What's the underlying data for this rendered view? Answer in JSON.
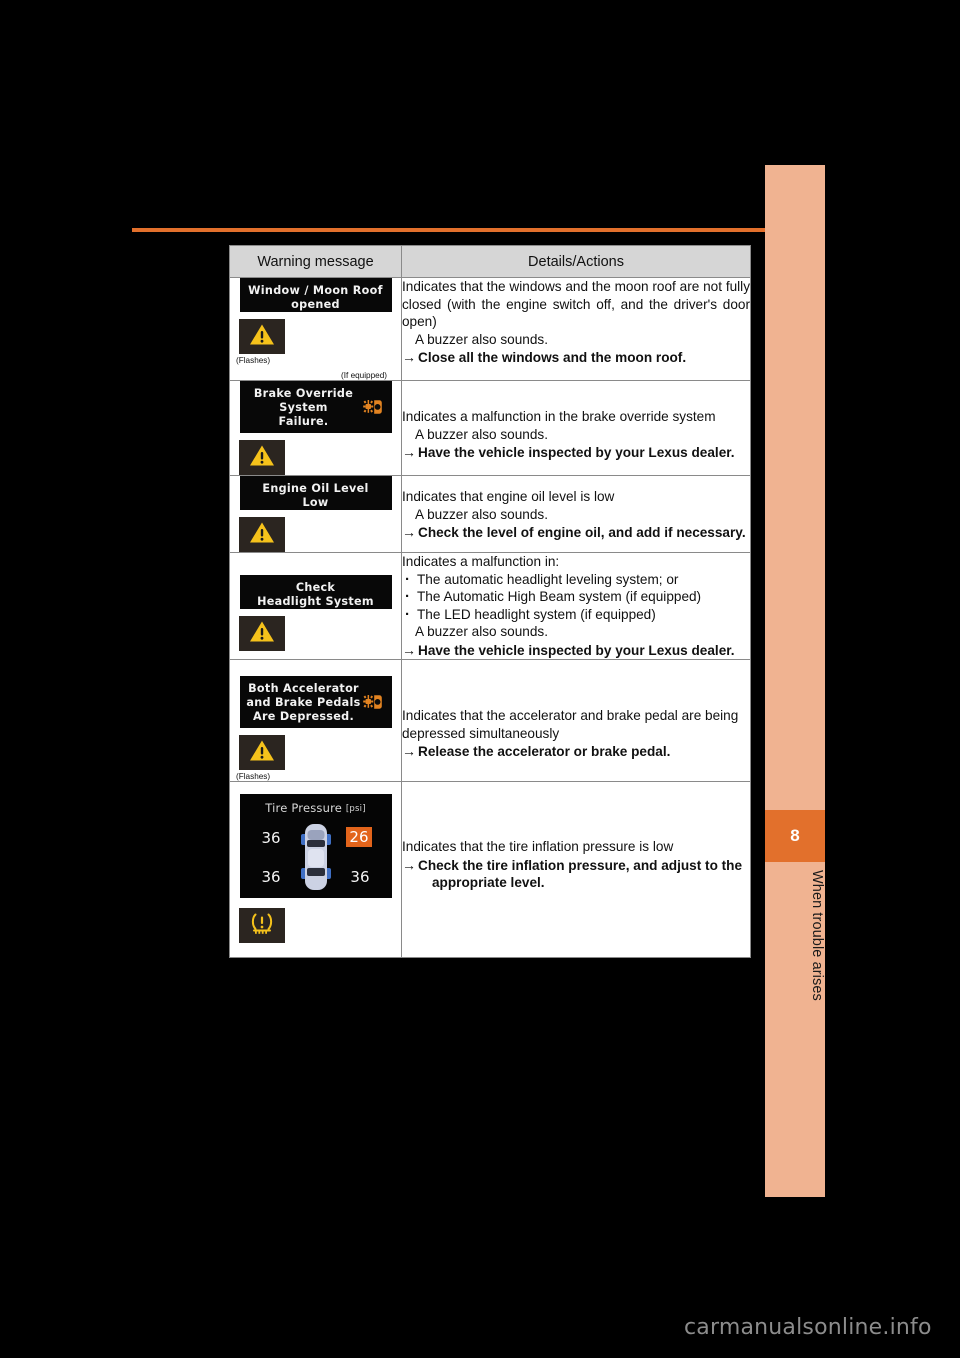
{
  "sidebar": {
    "chapter_number": "8",
    "chapter_title": "When trouble arises",
    "tab_color": "#f0b391",
    "chapter_box_color": "#e2702c"
  },
  "rule_color": "#e2702c",
  "table": {
    "headers": {
      "warning_message": "Warning message",
      "details_actions": "Details/Actions"
    },
    "rows": [
      {
        "display_lines": [
          "Window / Moon Roof",
          "opened"
        ],
        "display_icon": "none",
        "telltale": "warning-triangle-icon",
        "flashes_note": "(Flashes)",
        "if_equipped_note": "(If equipped)",
        "details_intro": "Indicates that the windows and the moon roof are not fully closed (with the engine switch off, and the driver's door open)",
        "details_buzzer": "A buzzer also sounds.",
        "action_arrow": "→",
        "action_text": "Close all the windows and the moon roof."
      },
      {
        "display_lines": [
          "Brake Override",
          "System",
          "Failure."
        ],
        "display_icon": "brake-system-icon",
        "telltale": "warning-triangle-icon",
        "flashes_note": "",
        "if_equipped_note": "",
        "details_intro": "Indicates a malfunction in the brake override system",
        "details_buzzer": "A buzzer also sounds.",
        "action_arrow": "→",
        "action_text": "Have the vehicle inspected by your Lexus dealer."
      },
      {
        "display_lines": [
          "Engine Oil Level",
          "Low"
        ],
        "display_icon": "none",
        "telltale": "warning-triangle-icon",
        "flashes_note": "",
        "if_equipped_note": "",
        "details_intro": "Indicates that engine oil level is low",
        "details_buzzer": "A buzzer also sounds.",
        "action_arrow": "→",
        "action_text": "Check the level of engine oil, and add if necessary."
      },
      {
        "display_lines": [
          "Check",
          "Headlight System"
        ],
        "display_icon": "none",
        "telltale": "warning-triangle-icon",
        "flashes_note": "",
        "if_equipped_note": "",
        "details_intro": "Indicates a malfunction in:",
        "details_bullets": [
          "The automatic headlight leveling system; or",
          "The Automatic High Beam system (if equipped)",
          "The LED headlight system (if equipped)"
        ],
        "details_buzzer": "A buzzer also sounds.",
        "action_arrow": "→",
        "action_text": "Have the vehicle inspected by your Lexus dealer."
      },
      {
        "display_lines": [
          "Both Accelerator",
          "and Brake Pedals",
          "Are Depressed."
        ],
        "display_icon": "brake-system-icon",
        "telltale": "warning-triangle-icon",
        "flashes_note": "(Flashes)",
        "if_equipped_note": "",
        "details_intro": "Indicates that the accelerator and brake pedal are being depressed simultaneously",
        "details_buzzer": "",
        "action_arrow": "→",
        "action_text": "Release the accelerator or brake pedal."
      },
      {
        "display_type": "tire-pressure",
        "tire_pressure": {
          "title": "Tire Pressure",
          "unit": "[psi]",
          "front_left": "36",
          "front_right": "26",
          "rear_left": "36",
          "rear_right": "36",
          "low_value_highlight_color": "#e2641b"
        },
        "telltale": "tpms-icon",
        "flashes_note": "",
        "if_equipped_note": "",
        "details_intro": "Indicates that the tire inflation pressure is low",
        "details_buzzer": "",
        "action_arrow": "→",
        "action_text": "Check the tire inflation pressure, and adjust to the",
        "action_text_line2": "appropriate level."
      }
    ]
  },
  "watermark": {
    "text": "carmanualsonline",
    "tld": ".info"
  }
}
